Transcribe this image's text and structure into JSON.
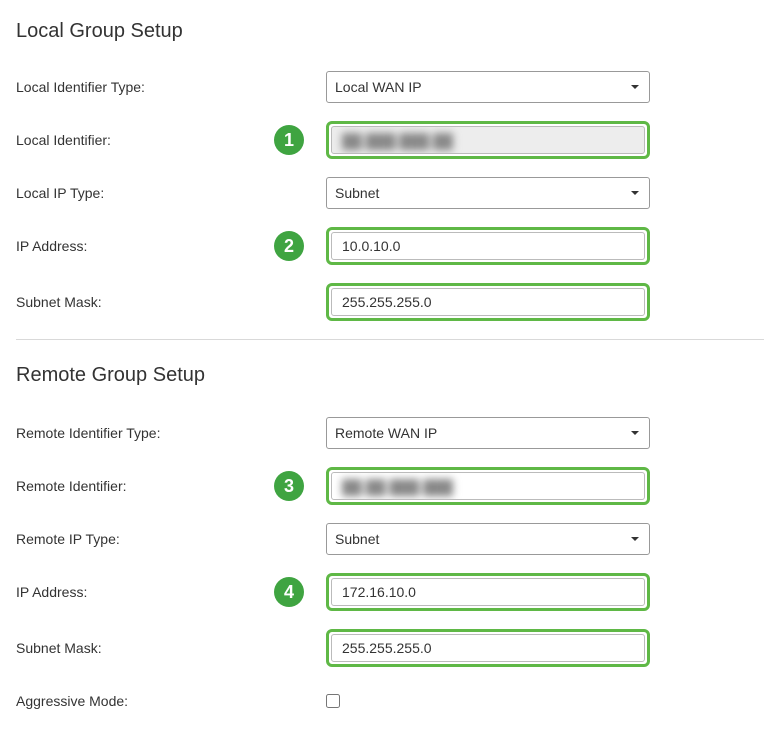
{
  "local": {
    "title": "Local Group Setup",
    "identifier_type": {
      "label": "Local Identifier Type:",
      "value": "Local WAN IP"
    },
    "identifier": {
      "label": "Local Identifier:",
      "value": "██.███.███.██",
      "badge": "1"
    },
    "ip_type": {
      "label": "Local IP Type:",
      "value": "Subnet"
    },
    "ip_address": {
      "label": "IP Address:",
      "value": "10.0.10.0",
      "badge": "2"
    },
    "subnet_mask": {
      "label": "Subnet Mask:",
      "value": "255.255.255.0"
    }
  },
  "remote": {
    "title": "Remote Group Setup",
    "identifier_type": {
      "label": "Remote Identifier Type:",
      "value": "Remote WAN IP"
    },
    "identifier": {
      "label": "Remote Identifier:",
      "value": "██.██.███.███",
      "badge": "3"
    },
    "ip_type": {
      "label": "Remote IP Type:",
      "value": "Subnet"
    },
    "ip_address": {
      "label": "IP Address:",
      "value": "172.16.10.0",
      "badge": "4"
    },
    "subnet_mask": {
      "label": "Subnet Mask:",
      "value": "255.255.255.0"
    },
    "aggressive_mode": {
      "label": "Aggressive Mode:",
      "checked": false
    }
  }
}
